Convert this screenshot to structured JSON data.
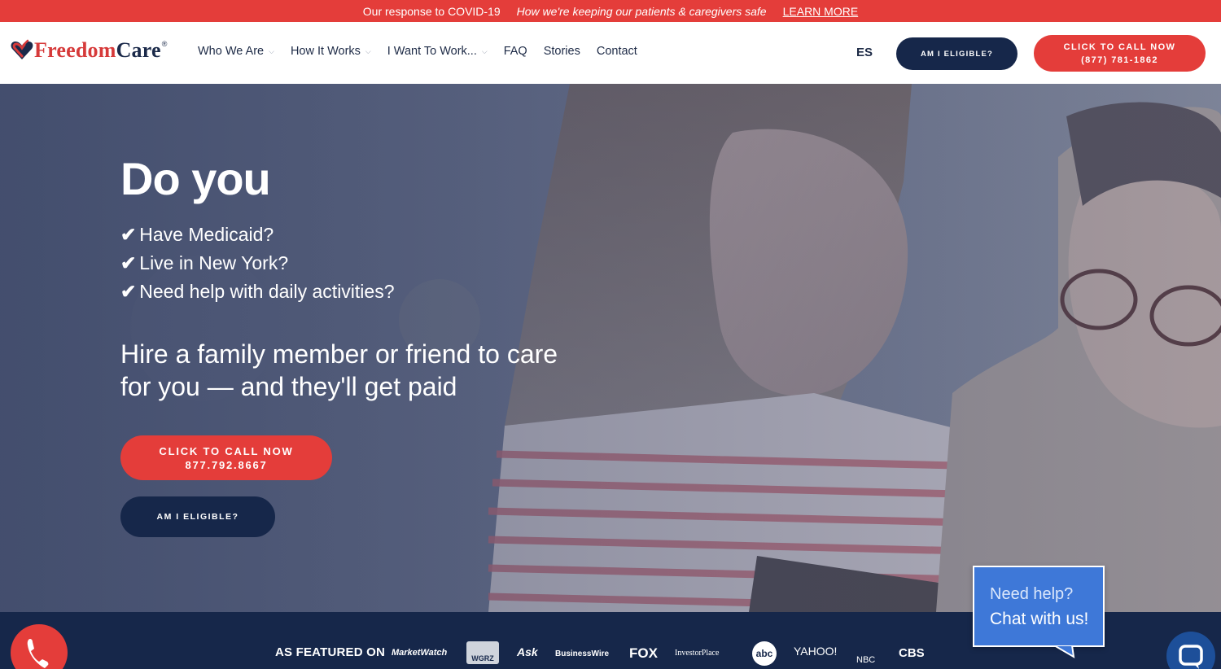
{
  "banner": {
    "title": "Our response to COVID-19",
    "subtitle": "How we're keeping our patients & caregivers safe",
    "link": "LEARN MORE"
  },
  "header": {
    "logo_freedom": "Freedom",
    "logo_care": "Care",
    "logo_reg": "®",
    "nav": [
      {
        "label": "Who We Are",
        "has_dropdown": true
      },
      {
        "label": "How It Works",
        "has_dropdown": true
      },
      {
        "label": "I Want To Work...",
        "has_dropdown": true
      },
      {
        "label": "FAQ",
        "has_dropdown": false
      },
      {
        "label": "Stories",
        "has_dropdown": false
      },
      {
        "label": "Contact",
        "has_dropdown": false
      }
    ],
    "lang": "ES",
    "eligible_button": "AM I ELIGIBLE?",
    "call_button_line1": "CLICK TO CALL NOW",
    "call_button_line2": "(877) 781-1862"
  },
  "hero": {
    "title": "Do you",
    "checklist": [
      {
        "mark": "✔",
        "text": "Have Medicaid?"
      },
      {
        "mark": "✔",
        "text": "Live in New York?"
      },
      {
        "mark": "✔",
        "text": "Need help with daily activities?"
      }
    ],
    "subtitle_line1": "Hire a family member or friend to care",
    "subtitle_line2": "for you — and they'll get paid",
    "call_button_line1": "CLICK TO CALL NOW",
    "call_button_line2": "877.792.8667",
    "eligible_button": "AM I ELIGIBLE?"
  },
  "featured": {
    "label": "AS FEATURED ON",
    "logos": [
      "MarketWatch",
      "WGRZ",
      "Ask",
      "BusinessWire",
      "FOX",
      "InvestorPlace",
      "abc",
      "YAHOO!",
      "NBC",
      "CBS"
    ]
  },
  "chat": {
    "line1": "Need help?",
    "line2": "Chat with us!"
  },
  "colors": {
    "brand_red": "#e43d3a",
    "brand_navy": "#16274a",
    "chat_blue": "#3e78d8"
  },
  "icons": {
    "phone_fab": "phone-icon",
    "chat_fab": "chat-icon"
  }
}
